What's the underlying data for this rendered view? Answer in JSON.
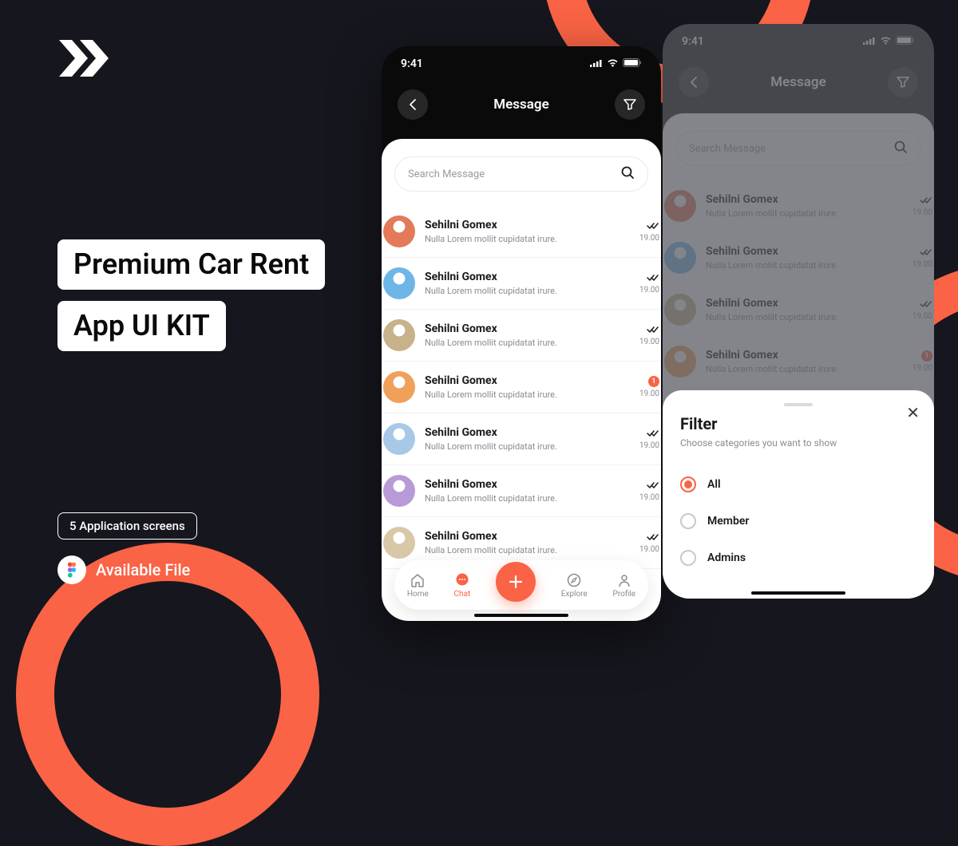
{
  "hero": {
    "title_line1": "Premium Car Rent",
    "title_line2": "App UI KIT",
    "screens_badge": "5 Application screens",
    "available_label": "Available File"
  },
  "phone_a": {
    "time": "9:41",
    "title": "Message",
    "search_placeholder": "Search Message",
    "chats": [
      {
        "name": "Sehilni Gomex",
        "sub": "Nulla Lorem mollit cupidatat irure.",
        "time": "19.00",
        "status": "read",
        "avatar": "#e37a5a"
      },
      {
        "name": "Sehilni Gomex",
        "sub": "Nulla Lorem mollit cupidatat irure.",
        "time": "19.00",
        "status": "read",
        "avatar": "#6fb6e8"
      },
      {
        "name": "Sehilni Gomex",
        "sub": "Nulla Lorem mollit cupidatat irure.",
        "time": "19.00",
        "status": "read",
        "avatar": "#c8b28a"
      },
      {
        "name": "Sehilni Gomex",
        "sub": "Nulla Lorem mollit cupidatat irure.",
        "time": "19.00",
        "status": "unread",
        "unread": "1",
        "avatar": "#f0a05a"
      },
      {
        "name": "Sehilni Gomex",
        "sub": "Nulla Lorem mollit cupidatat irure.",
        "time": "19.00",
        "status": "read",
        "avatar": "#a8c8e8"
      },
      {
        "name": "Sehilni Gomex",
        "sub": "Nulla Lorem mollit cupidatat irure.",
        "time": "19.00",
        "status": "read",
        "avatar": "#b89ad8"
      },
      {
        "name": "Sehilni Gomex",
        "sub": "Nulla Lorem mollit cupidatat irure.",
        "time": "19.00",
        "status": "read",
        "avatar": "#d8c8a8"
      }
    ],
    "tabs": {
      "home": "Home",
      "chat": "Chat",
      "explore": "Explore",
      "profile": "Profile"
    }
  },
  "phone_b": {
    "time": "9:41",
    "title": "Message",
    "search_placeholder": "Search Message",
    "chats": [
      {
        "name": "Sehilni Gomex",
        "sub": "Nulla Lorem mollit cupidatat irure.",
        "time": "19.00",
        "status": "read",
        "avatar": "#e37a5a"
      },
      {
        "name": "Sehilni Gomex",
        "sub": "Nulla Lorem mollit cupidatat irure.",
        "time": "19.00",
        "status": "read",
        "avatar": "#6fb6e8"
      },
      {
        "name": "Sehilni Gomex",
        "sub": "Nulla Lorem mollit cupidatat irure.",
        "time": "19.00",
        "status": "read",
        "avatar": "#c8b28a"
      },
      {
        "name": "Sehilni Gomex",
        "sub": "Nulla Lorem mollit cupidatat irure.",
        "time": "19.00",
        "status": "unread",
        "unread": "1",
        "avatar": "#f0a05a"
      }
    ],
    "filter": {
      "title": "Filter",
      "subtitle": "Choose categories you want to show",
      "options": [
        {
          "label": "All",
          "selected": true
        },
        {
          "label": "Member",
          "selected": false
        },
        {
          "label": "Admins",
          "selected": false
        }
      ]
    }
  }
}
